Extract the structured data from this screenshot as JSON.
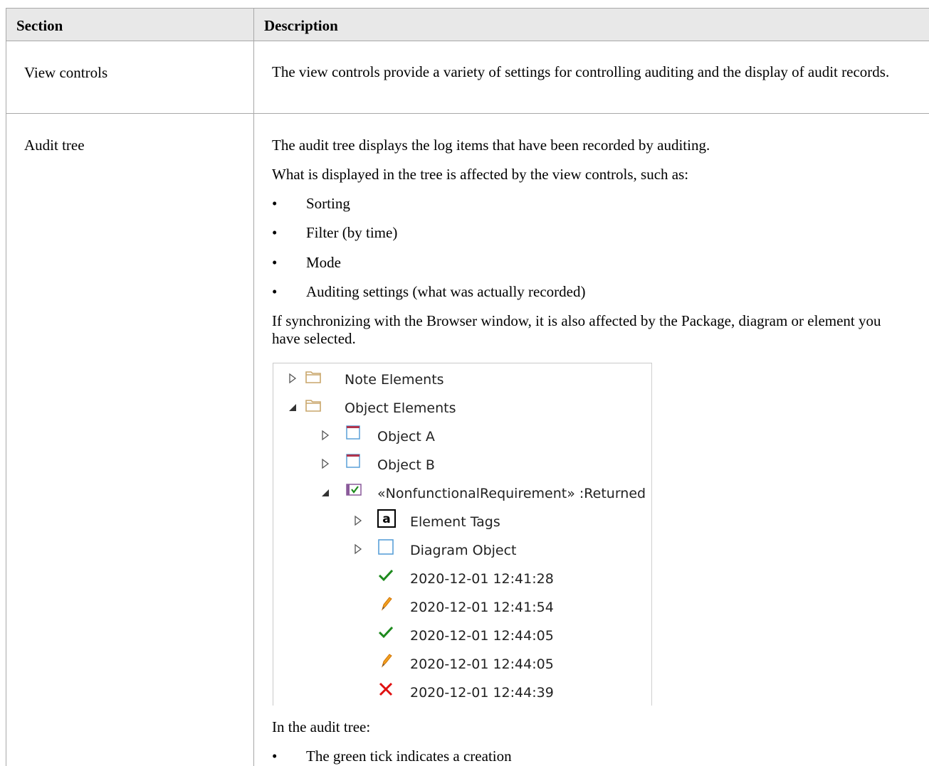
{
  "table": {
    "headers": {
      "section": "Section",
      "description": "Description"
    },
    "rows": [
      {
        "section": "View controls",
        "description": "The view controls provide a variety of settings for controlling auditing and the display of audit records."
      },
      {
        "section": "Audit tree",
        "intro": "The audit tree displays the log items that have been recorded by auditing.",
        "lead": "What is displayed in the tree is affected by the view controls, such as:",
        "bullets": [
          "Sorting",
          "Filter (by time)",
          "Mode",
          "Auditing settings (what was actually recorded)"
        ],
        "sync_note": "If synchronizing with the Browser window, it is also affected by the Package, diagram or element you have selected.",
        "after_tree": "In the audit tree:",
        "after_bullets": [
          "The green tick indicates a creation"
        ]
      }
    ]
  },
  "tree": {
    "items": [
      {
        "label": "Note Elements",
        "icon": "folder-icon",
        "expander": "collapsed"
      },
      {
        "label": "Object Elements",
        "icon": "folder-icon",
        "expander": "expanded"
      },
      {
        "label": "Object A",
        "icon": "object-icon",
        "expander": "collapsed"
      },
      {
        "label": "Object B",
        "icon": "object-icon",
        "expander": "collapsed"
      },
      {
        "label": "«NonfunctionalRequirement» :Returned",
        "icon": "requirement-icon",
        "expander": "expanded"
      },
      {
        "label": "Element Tags",
        "icon": "tag-icon",
        "expander": "collapsed"
      },
      {
        "label": "Diagram Object",
        "icon": "diagram-object-icon",
        "expander": "collapsed"
      },
      {
        "label": "2020-12-01 12:41:28",
        "icon": "green-tick-icon",
        "expander": "none"
      },
      {
        "label": "2020-12-01 12:41:54",
        "icon": "pencil-icon",
        "expander": "none"
      },
      {
        "label": "2020-12-01 12:44:05",
        "icon": "green-tick-icon",
        "expander": "none"
      },
      {
        "label": "2020-12-01 12:44:05",
        "icon": "pencil-icon",
        "expander": "none"
      },
      {
        "label": "2020-12-01 12:44:39",
        "icon": "red-cross-icon",
        "expander": "none"
      }
    ],
    "tag_icon_glyph": "a",
    "colors": {
      "folder": "#c9a66b",
      "object_header": "#b0344d",
      "object_body": "#5aa0d8",
      "tick": "#1d8a1d",
      "pencil": "#f0a020",
      "cross": "#e01010",
      "header_bg": "#e8e8e8"
    }
  }
}
